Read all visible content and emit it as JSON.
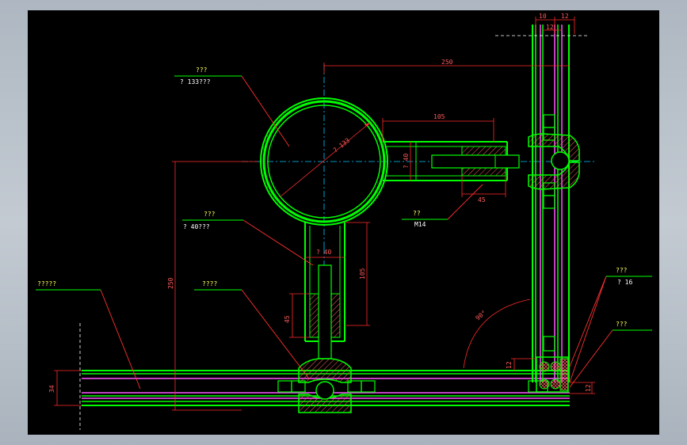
{
  "drawing": {
    "colors": {
      "background": "#000000",
      "outline": "#00ff00",
      "dimension": "#ff2a2a",
      "centerline": "#00c8ff",
      "label": "#ffff55",
      "leader": "#ff3030",
      "magenta": "#ff55ff",
      "hatch": "#ff6060"
    },
    "labels": {
      "handrail_title": "???",
      "handrail_spec": "? 133???",
      "post_title": "???",
      "post_spec": "? 40???",
      "bolt_title": "??",
      "bolt_spec": "M14",
      "left_panel": "?????",
      "lower_mid": "????",
      "right_top_title": "???",
      "right_top_spec": "? 16",
      "right_bottom": "???"
    },
    "dimensions": {
      "top_span": "250",
      "left_span": "250",
      "arm_length": "105",
      "post_length": "105",
      "arm_insert": "45",
      "post_insert": "45",
      "pipe_dia": "? 133",
      "arm_dia": "? 40",
      "post_dia": "? 40",
      "panel_thickness": "34",
      "angle": "90°",
      "gap_left": "12",
      "gap_right": "12",
      "top_10": "10",
      "top_12": "12",
      "top_12b": "12"
    }
  }
}
